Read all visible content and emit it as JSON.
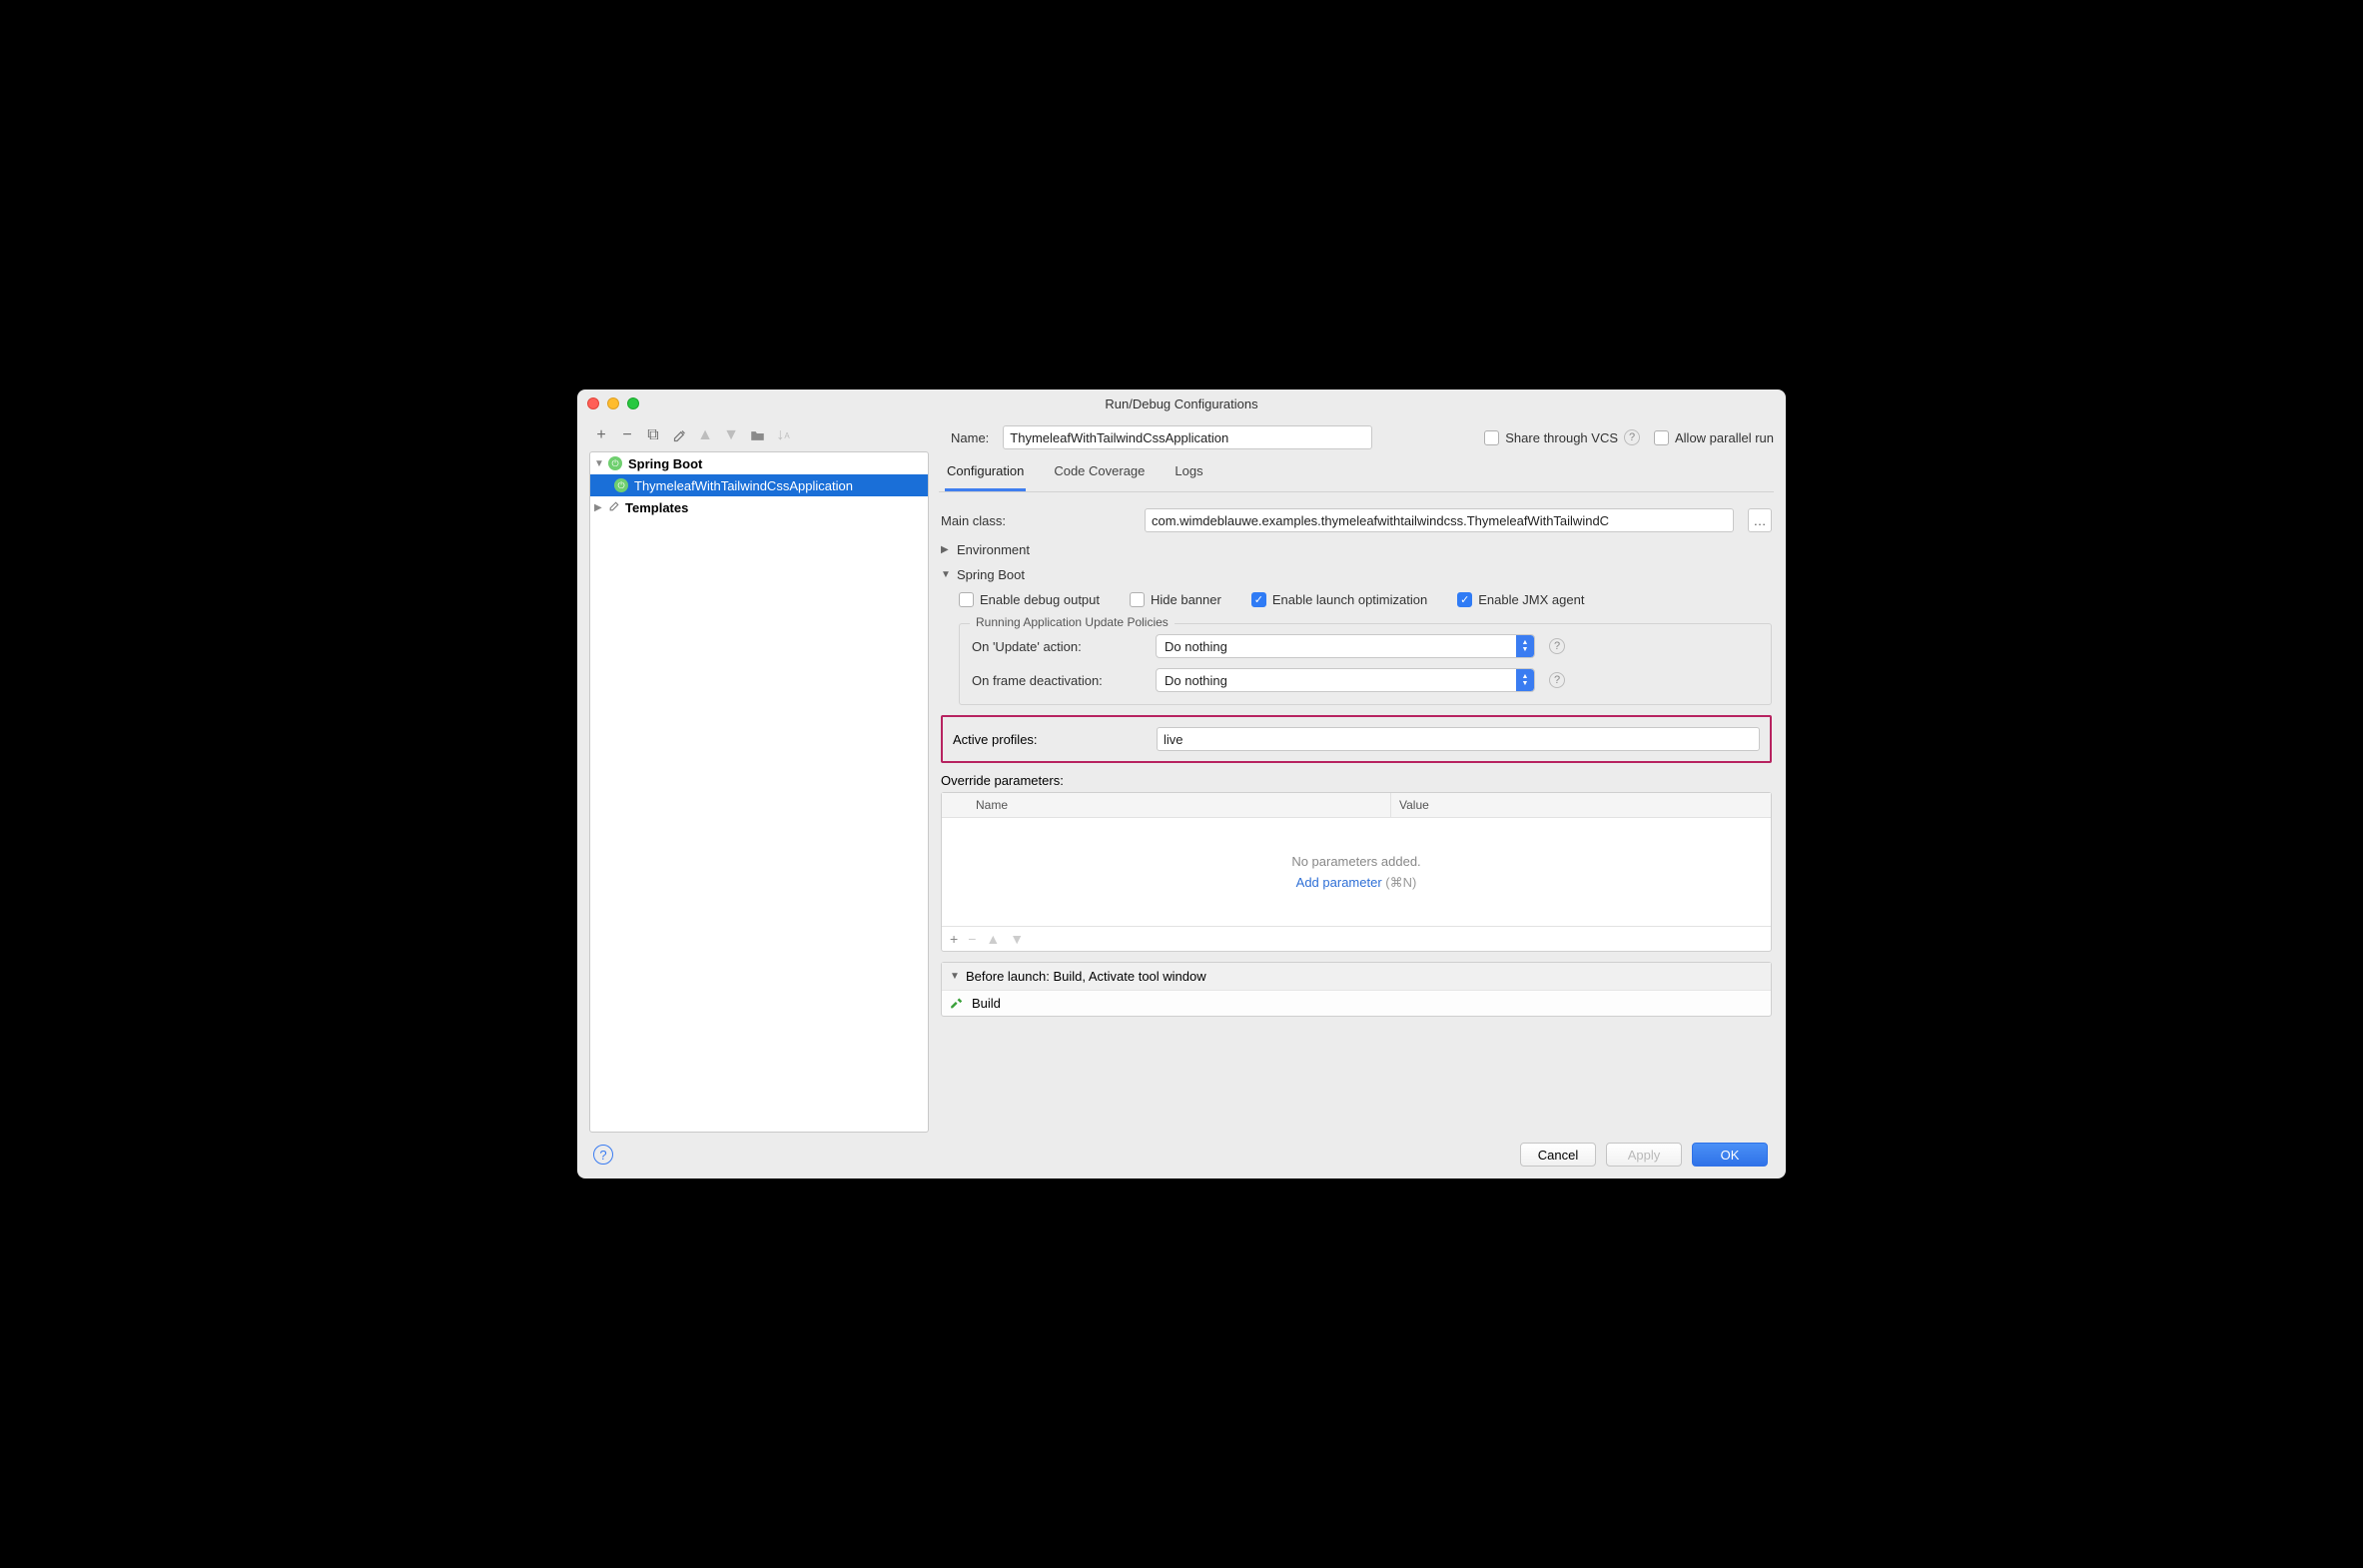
{
  "title": "Run/Debug Configurations",
  "toolbar": {
    "add": "+",
    "remove": "−",
    "copy": "⧉",
    "edit": "🔧",
    "up": "▲",
    "down": "▼",
    "folder": "📁",
    "sort": "↓z"
  },
  "tree": {
    "root": {
      "label": "Spring Boot",
      "expanded": true
    },
    "child": {
      "label": "ThymeleafWithTailwindCssApplication"
    },
    "templates": {
      "label": "Templates"
    }
  },
  "name": {
    "label": "Name:",
    "value": "ThymeleafWithTailwindCssApplication"
  },
  "share": {
    "label": "Share through VCS",
    "checked": false
  },
  "parallel": {
    "label": "Allow parallel run",
    "checked": false
  },
  "tabs": {
    "configuration": "Configuration",
    "coverage": "Code Coverage",
    "logs": "Logs"
  },
  "mainClass": {
    "label": "Main class:",
    "value": "com.wimdeblauwe.examples.thymeleafwithtailwindcss.ThymeleafWithTailwindC"
  },
  "env": {
    "label": "Environment"
  },
  "springBoot": {
    "label": "Spring Boot",
    "debug": {
      "label": "Enable debug output",
      "checked": false
    },
    "hideBanner": {
      "label": "Hide banner",
      "checked": false
    },
    "launchOpt": {
      "label": "Enable launch optimization",
      "checked": true
    },
    "jmx": {
      "label": "Enable JMX agent",
      "checked": true
    },
    "policies": {
      "legend": "Running Application Update Policies",
      "updateLabel": "On 'Update' action:",
      "updateValue": "Do nothing",
      "deactLabel": "On frame deactivation:",
      "deactValue": "Do nothing"
    }
  },
  "activeProfiles": {
    "label": "Active profiles:",
    "value": "live"
  },
  "override": {
    "label": "Override parameters:",
    "cols": {
      "name": "Name",
      "value": "Value"
    },
    "empty": "No parameters added.",
    "addLink": "Add parameter",
    "shortcut": "(⌘N)"
  },
  "beforeLaunch": {
    "header": "Before launch: Build, Activate tool window",
    "build": "Build"
  },
  "buttons": {
    "cancel": "Cancel",
    "apply": "Apply",
    "ok": "OK"
  }
}
